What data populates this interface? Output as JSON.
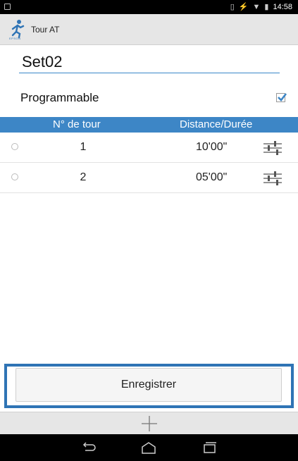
{
  "status_bar": {
    "time": "14:58"
  },
  "app": {
    "title": "Tour AT",
    "icon_caption": "EPSON"
  },
  "form": {
    "name_value": "Set02",
    "programmable_label": "Programmable",
    "programmable_checked": true
  },
  "table": {
    "headers": {
      "tour": "N° de tour",
      "distance": "Distance/Durée"
    },
    "rows": [
      {
        "number": "1",
        "duration": "10'00\""
      },
      {
        "number": "2",
        "duration": "05'00\""
      }
    ]
  },
  "buttons": {
    "save_label": "Enregistrer"
  },
  "colors": {
    "accent": "#3d86c6",
    "highlight_frame": "#2f74b5"
  }
}
